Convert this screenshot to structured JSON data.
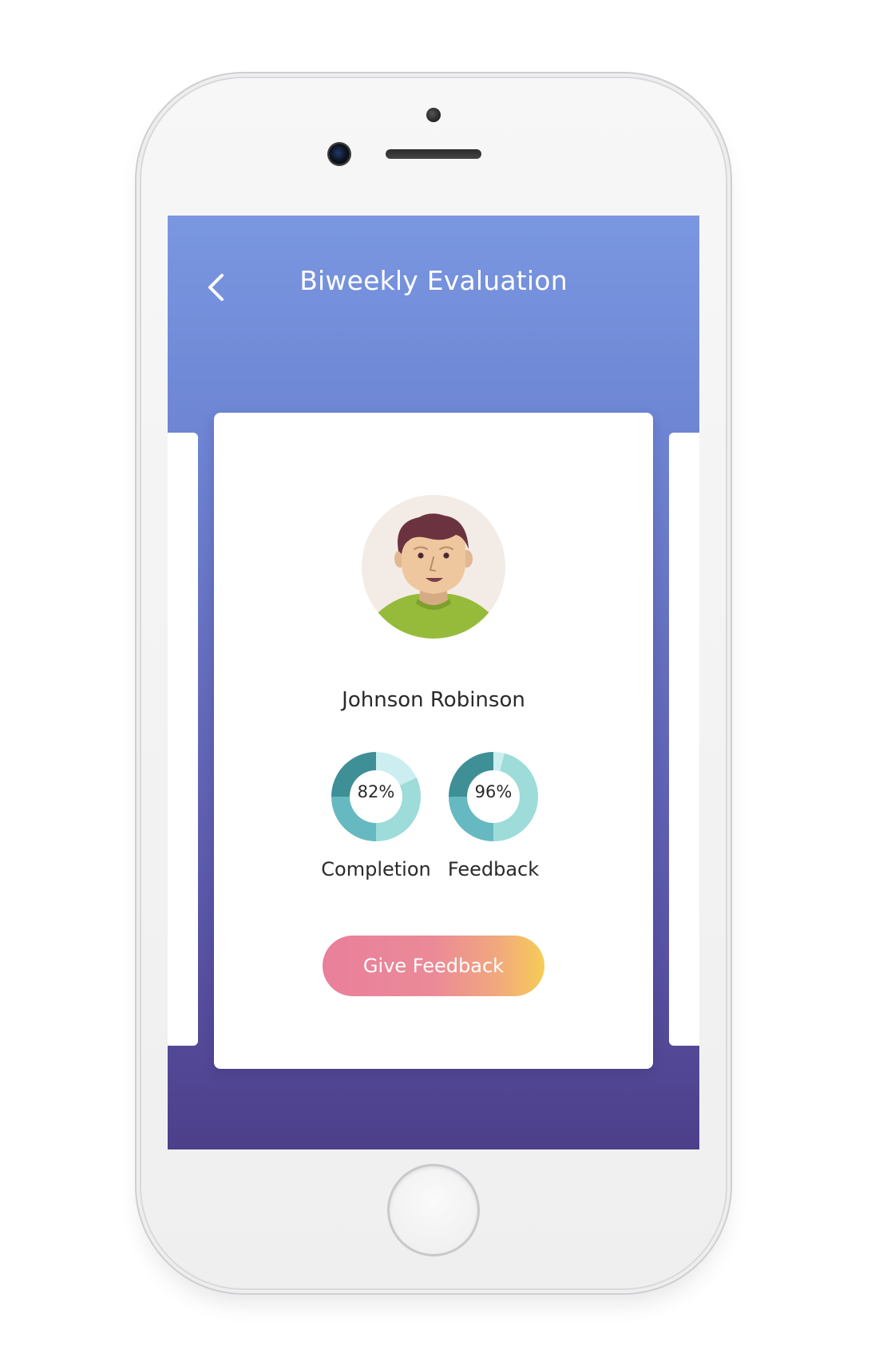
{
  "header": {
    "title": "Biweekly Evaluation",
    "back_icon": "chevron-left-icon"
  },
  "profile": {
    "name": "Johnson Robinson",
    "avatar_icon": "avatar-illustration"
  },
  "stats": [
    {
      "label": "Completion",
      "value_text": "82%",
      "value": 0.82
    },
    {
      "label": "Feedback",
      "value_text": "96%",
      "value": 0.96
    }
  ],
  "actions": {
    "give_feedback_label": "Give Feedback"
  },
  "colors": {
    "header_gradient_top": "#7a97e1",
    "header_gradient_bottom": "#4d3f8a",
    "donut_dark": "#3f8f96",
    "donut_mid": "#66b9c0",
    "donut_light": "#9ddcd8",
    "donut_track": "#cdeef0",
    "button_gradient_start": "#e97f9c",
    "button_gradient_end": "#f6cc57"
  }
}
